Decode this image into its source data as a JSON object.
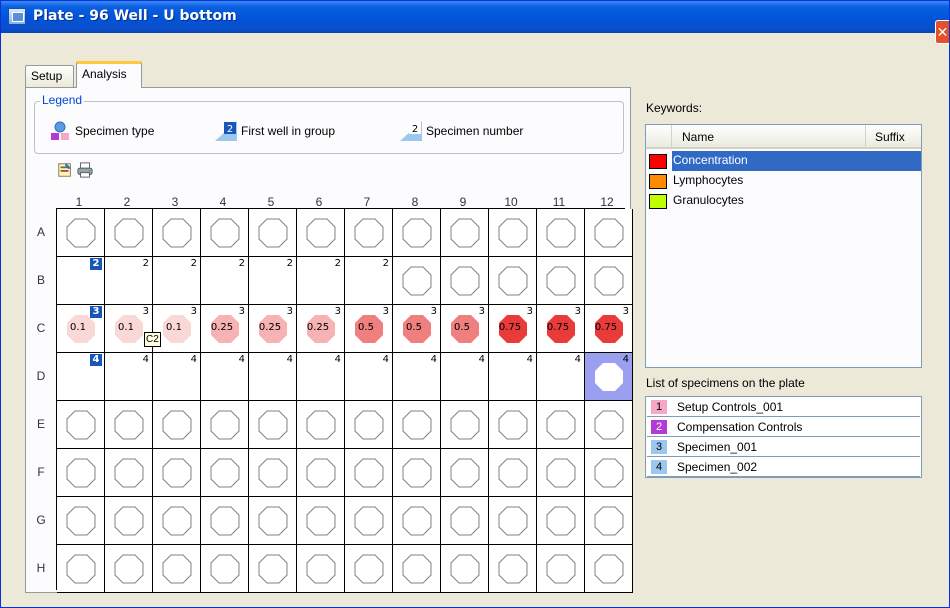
{
  "window": {
    "title": "Plate - 96 Well - U bottom",
    "close_glyph": "✕"
  },
  "tabs": [
    {
      "label": "Setup"
    },
    {
      "label": "Analysis"
    }
  ],
  "legend": {
    "title": "Legend",
    "items": [
      {
        "label": "Specimen type",
        "icon": "specimen-type-icon"
      },
      {
        "label": "First well in group",
        "icon": "first-well-icon",
        "sample": "2"
      },
      {
        "label": "Specimen number",
        "icon": "specimen-number-icon",
        "sample": "2"
      }
    ]
  },
  "toolbar": {
    "buttons": [
      {
        "icon": "properties-icon"
      },
      {
        "icon": "print-icon"
      }
    ]
  },
  "plate": {
    "columns": [
      "1",
      "2",
      "3",
      "4",
      "5",
      "6",
      "7",
      "8",
      "9",
      "10",
      "11",
      "12"
    ],
    "rows": [
      "A",
      "B",
      "C",
      "D",
      "E",
      "F",
      "G",
      "H"
    ],
    "colors": {
      "c_0_1": "#fbd8d8",
      "c_0_25": "#f7b3b3",
      "c_0_5": "#f07f7f",
      "c_0_75": "#ea3b3b",
      "selected": "#9a9ff0"
    },
    "wells": [
      {
        "row": "B",
        "col": 1,
        "num": "2",
        "first": true
      },
      {
        "row": "B",
        "col": 2,
        "num": "2"
      },
      {
        "row": "B",
        "col": 3,
        "num": "2"
      },
      {
        "row": "B",
        "col": 4,
        "num": "2"
      },
      {
        "row": "B",
        "col": 5,
        "num": "2"
      },
      {
        "row": "B",
        "col": 6,
        "num": "2"
      },
      {
        "row": "B",
        "col": 7,
        "num": "2"
      },
      {
        "row": "C",
        "col": 1,
        "num": "3",
        "first": true,
        "conc": "0.1",
        "fill": "c_0_1"
      },
      {
        "row": "C",
        "col": 2,
        "num": "3",
        "conc": "0.1",
        "fill": "c_0_1"
      },
      {
        "row": "C",
        "col": 3,
        "num": "3",
        "conc": "0.1",
        "fill": "c_0_1"
      },
      {
        "row": "C",
        "col": 4,
        "num": "3",
        "conc": "0.25",
        "fill": "c_0_25"
      },
      {
        "row": "C",
        "col": 5,
        "num": "3",
        "conc": "0.25",
        "fill": "c_0_25"
      },
      {
        "row": "C",
        "col": 6,
        "num": "3",
        "conc": "0.25",
        "fill": "c_0_25"
      },
      {
        "row": "C",
        "col": 7,
        "num": "3",
        "conc": "0.5",
        "fill": "c_0_5"
      },
      {
        "row": "C",
        "col": 8,
        "num": "3",
        "conc": "0.5",
        "fill": "c_0_5"
      },
      {
        "row": "C",
        "col": 9,
        "num": "3",
        "conc": "0.5",
        "fill": "c_0_5"
      },
      {
        "row": "C",
        "col": 10,
        "num": "3",
        "conc": "0.75",
        "fill": "c_0_75"
      },
      {
        "row": "C",
        "col": 11,
        "num": "3",
        "conc": "0.75",
        "fill": "c_0_75"
      },
      {
        "row": "C",
        "col": 12,
        "num": "3",
        "conc": "0.75",
        "fill": "c_0_75"
      },
      {
        "row": "D",
        "col": 1,
        "num": "4",
        "first": true
      },
      {
        "row": "D",
        "col": 2,
        "num": "4"
      },
      {
        "row": "D",
        "col": 3,
        "num": "4"
      },
      {
        "row": "D",
        "col": 4,
        "num": "4"
      },
      {
        "row": "D",
        "col": 5,
        "num": "4"
      },
      {
        "row": "D",
        "col": 6,
        "num": "4"
      },
      {
        "row": "D",
        "col": 7,
        "num": "4"
      },
      {
        "row": "D",
        "col": 8,
        "num": "4"
      },
      {
        "row": "D",
        "col": 9,
        "num": "4"
      },
      {
        "row": "D",
        "col": 10,
        "num": "4"
      },
      {
        "row": "D",
        "col": 11,
        "num": "4"
      },
      {
        "row": "D",
        "col": 12,
        "num": "4",
        "selected": true
      }
    ],
    "tooltip": "C2"
  },
  "keywords": {
    "label": "Keywords:",
    "headers": {
      "name": "Name",
      "suffix": "Suffix"
    },
    "items": [
      {
        "name": "Concentration",
        "color": "#ff0000",
        "selected": true
      },
      {
        "name": "Lymphocytes",
        "color": "#ff8c00"
      },
      {
        "name": "Granulocytes",
        "color": "#bfff00"
      }
    ]
  },
  "specimens": {
    "label": "List of specimens on the plate",
    "items": [
      {
        "num": "1",
        "name": "Setup Controls_001",
        "color": "#f7a6c8"
      },
      {
        "num": "2",
        "name": "Compensation Controls",
        "color": "#b23bd6"
      },
      {
        "num": "3",
        "name": "Specimen_001",
        "color": "#9cc7ee"
      },
      {
        "num": "4",
        "name": "Specimen_002",
        "color": "#9cc7ee"
      }
    ]
  }
}
